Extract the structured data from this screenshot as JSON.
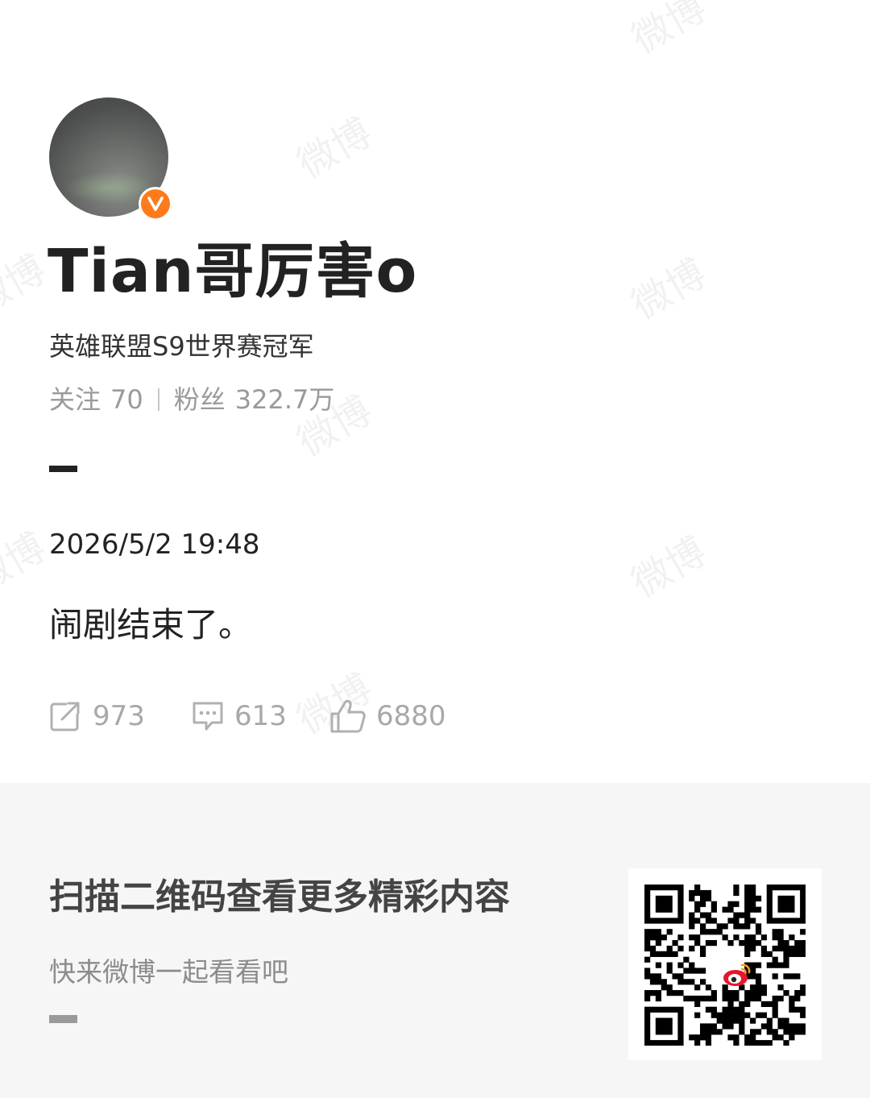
{
  "watermark_text": "微博",
  "profile": {
    "username": "Tian哥厉害o",
    "verified_description": "英雄联盟S9世界赛冠军",
    "following_label": "关注",
    "following_count": "70",
    "followers_label": "粉丝",
    "followers_count": "322.7万",
    "badge_icon": "verified-v-icon",
    "badge_color": "#ff7a1a"
  },
  "post": {
    "time": "2026/5/2 19:48",
    "text": "闹剧结束了。",
    "repost_count": "973",
    "comment_count": "613",
    "like_count": "6880",
    "icons": [
      "repost-icon",
      "comment-icon",
      "like-icon"
    ]
  },
  "footer": {
    "title": "扫描二维码查看更多精彩内容",
    "subtitle": "快来微博一起看看吧",
    "qr_icon": "qr-code-icon",
    "logo_icon": "weibo-logo-icon"
  },
  "colors": {
    "text_primary": "#222222",
    "text_muted": "#9a9a9a",
    "footer_bg": "#f6f6f6",
    "weibo_red": "#e6162d"
  }
}
